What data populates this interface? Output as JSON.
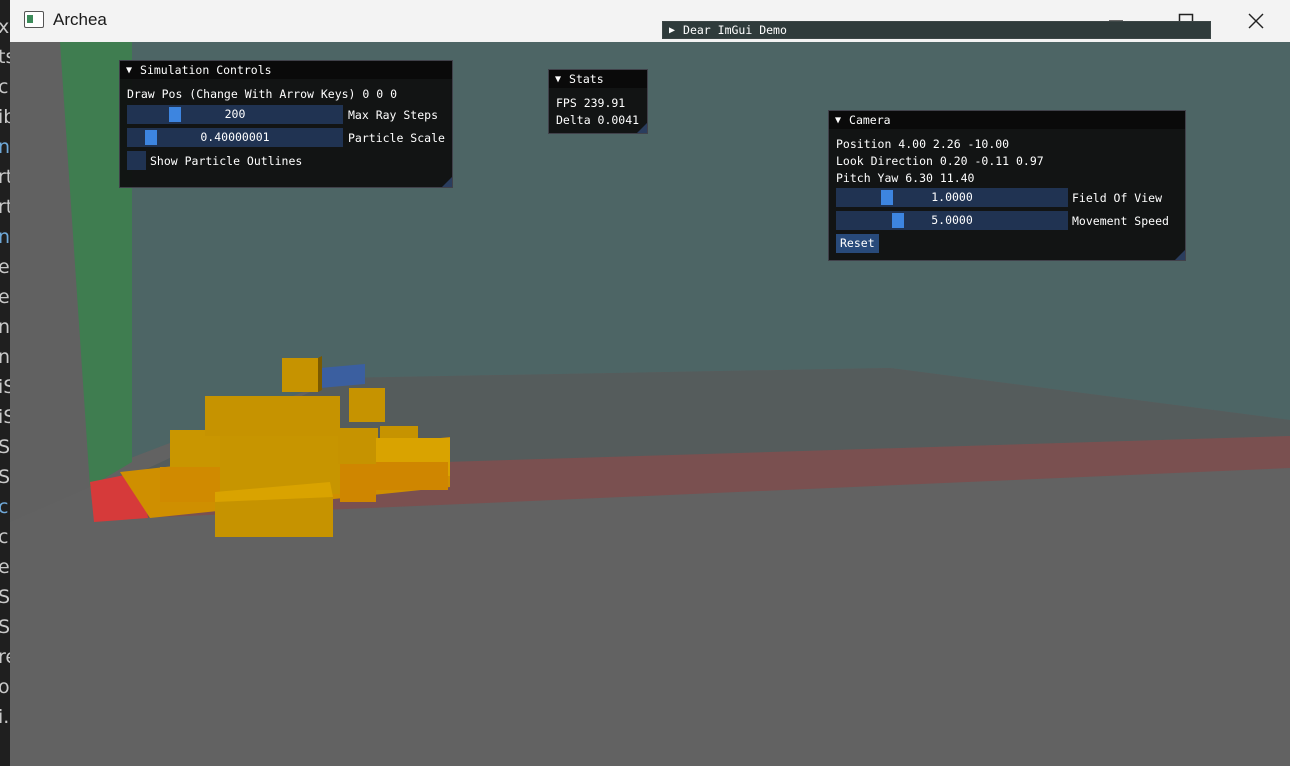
{
  "window": {
    "title": "Archea"
  },
  "simulation_controls": {
    "title": "Simulation Controls",
    "draw_pos_text": "Draw Pos (Change With Arrow Keys) 0 0 0",
    "max_ray_steps": {
      "value": "200",
      "label": "Max Ray Steps",
      "fraction": 0.25
    },
    "particle_scale": {
      "value": "0.40000001",
      "label": "Particle Scale",
      "fraction": 0.1
    },
    "show_outlines": {
      "label": "Show Particle Outlines",
      "checked": false
    }
  },
  "stats": {
    "title": "Stats",
    "fps": "FPS 239.91",
    "delta": "Delta 0.0041"
  },
  "demo": {
    "title": "Dear ImGui Demo"
  },
  "camera": {
    "title": "Camera",
    "position": "Position 4.00 2.26 -10.00",
    "look_direction": "Look Direction 0.20 -0.11 0.97",
    "pitch_yaw": "Pitch Yaw 6.30 11.40",
    "field_of_view": {
      "value": "1.0000",
      "label": "Field Of View",
      "fraction": 0.3
    },
    "movement_speed": {
      "value": "5.0000",
      "label": "Movement Speed",
      "fraction": 0.4
    },
    "reset_label": "Reset"
  },
  "colors": {
    "accent": "#3d85e0",
    "frame": "#203352",
    "particle": "#d9a300"
  },
  "left_edge_fragments": [
    "x",
    "ts",
    "cl",
    "ib",
    "n",
    "rt",
    "rt",
    "n",
    "er",
    "er",
    "ni",
    "ni",
    "iS",
    "iS",
    "S",
    "S",
    "cl",
    "cl",
    "er",
    "Si",
    "Si",
    "re",
    "o",
    "i."
  ]
}
